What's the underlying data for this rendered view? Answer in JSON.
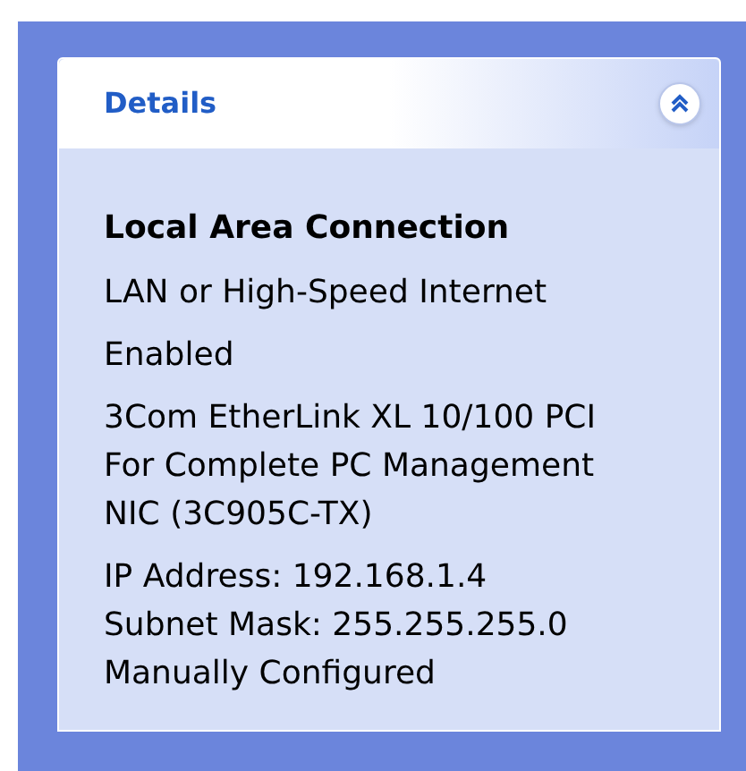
{
  "panel": {
    "title": "Details",
    "expanded": true
  },
  "name": "Local Area Connection",
  "groups": [
    [
      "LAN or High-Speed Internet"
    ],
    [
      "Enabled"
    ],
    [
      "3Com EtherLink XL 10/100 PCI",
      "For Complete PC Management",
      "NIC (3C905C-TX)"
    ],
    [
      "IP Address: 192.168.1.4",
      "Subnet Mask: 255.255.255.0",
      "Manually Configured"
    ]
  ]
}
